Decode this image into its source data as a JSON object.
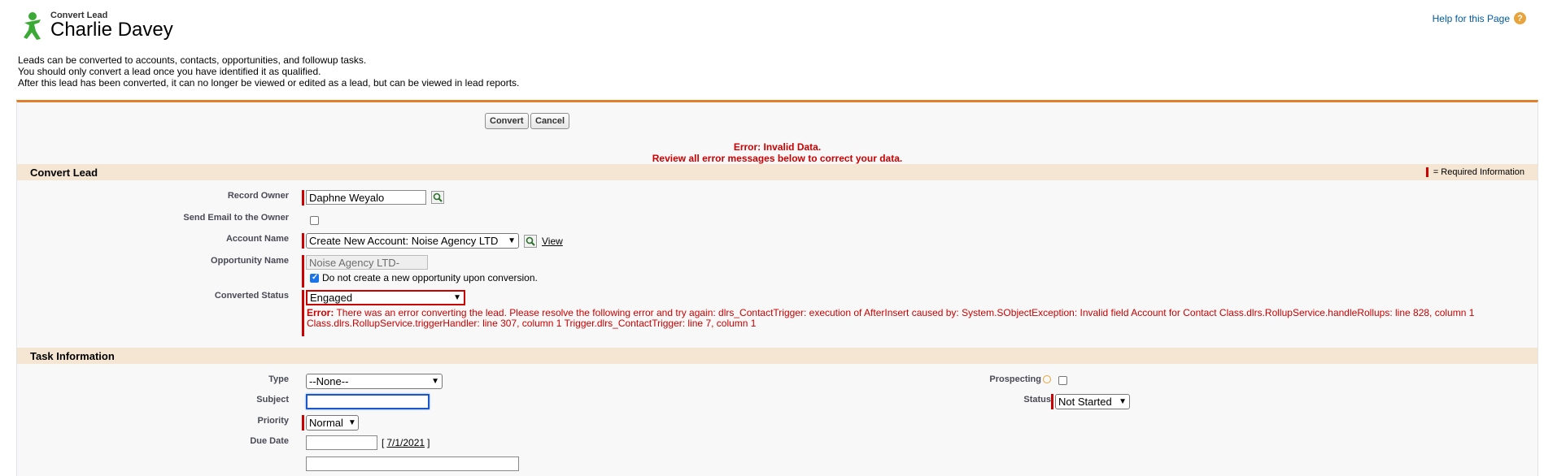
{
  "header": {
    "kicker": "Convert Lead",
    "title": "Charlie Davey",
    "help_link": "Help for this Page",
    "help_icon": "?"
  },
  "intro": [
    "Leads can be converted to accounts, contacts, opportunities, and followup tasks.",
    "You should only convert a lead once you have identified it as qualified.",
    "After this lead has been converted, it can no longer be viewed or edited as a lead, but can be viewed in lead reports."
  ],
  "buttons": {
    "convert": "Convert",
    "cancel": "Cancel"
  },
  "error_header": {
    "line1": "Error: Invalid Data.",
    "line2": "Review all error messages below to correct your data."
  },
  "convert_section": {
    "title": "Convert Lead",
    "required_legend": "= Required Information",
    "record_owner": {
      "label": "Record Owner",
      "value": "Daphne Weyalo"
    },
    "send_email": {
      "label": "Send Email to the Owner",
      "checked": false
    },
    "account_name": {
      "label": "Account Name",
      "value": "Create New Account: Noise Agency LTD",
      "view_link": "View"
    },
    "opportunity_name": {
      "label": "Opportunity Name",
      "value": "Noise Agency LTD-",
      "no_opp_label": "Do not create a new opportunity upon conversion.",
      "no_opp_checked": true
    },
    "converted_status": {
      "label": "Converted Status",
      "value": "Engaged",
      "error_prefix": "Error:",
      "error_line1": "There was an error converting the lead. Please resolve the following error and try again: dlrs_ContactTrigger: execution of AfterInsert caused by: System.SObjectException: Invalid field Account for Contact Class.dlrs.RollupService.handleRollups: line 828, column 1",
      "error_line2": "Class.dlrs.RollupService.triggerHandler: line 307, column 1 Trigger.dlrs_ContactTrigger: line 7, column 1"
    }
  },
  "task_section": {
    "title": "Task Information",
    "type": {
      "label": "Type",
      "value": "--None--"
    },
    "subject": {
      "label": "Subject",
      "value": ""
    },
    "priority": {
      "label": "Priority",
      "value": "Normal"
    },
    "due_date": {
      "label": "Due Date",
      "value": "",
      "bracket_open": "[",
      "today_link": "7/1/2021",
      "bracket_close": "]"
    },
    "prospecting": {
      "label": "Prospecting",
      "checked": false
    },
    "status": {
      "label": "Status",
      "value": "Not Started"
    }
  },
  "colors": {
    "accent": "#e17e2a",
    "error": "#cc0000",
    "section_bg": "#f5e6d3",
    "link": "#015ba7"
  }
}
